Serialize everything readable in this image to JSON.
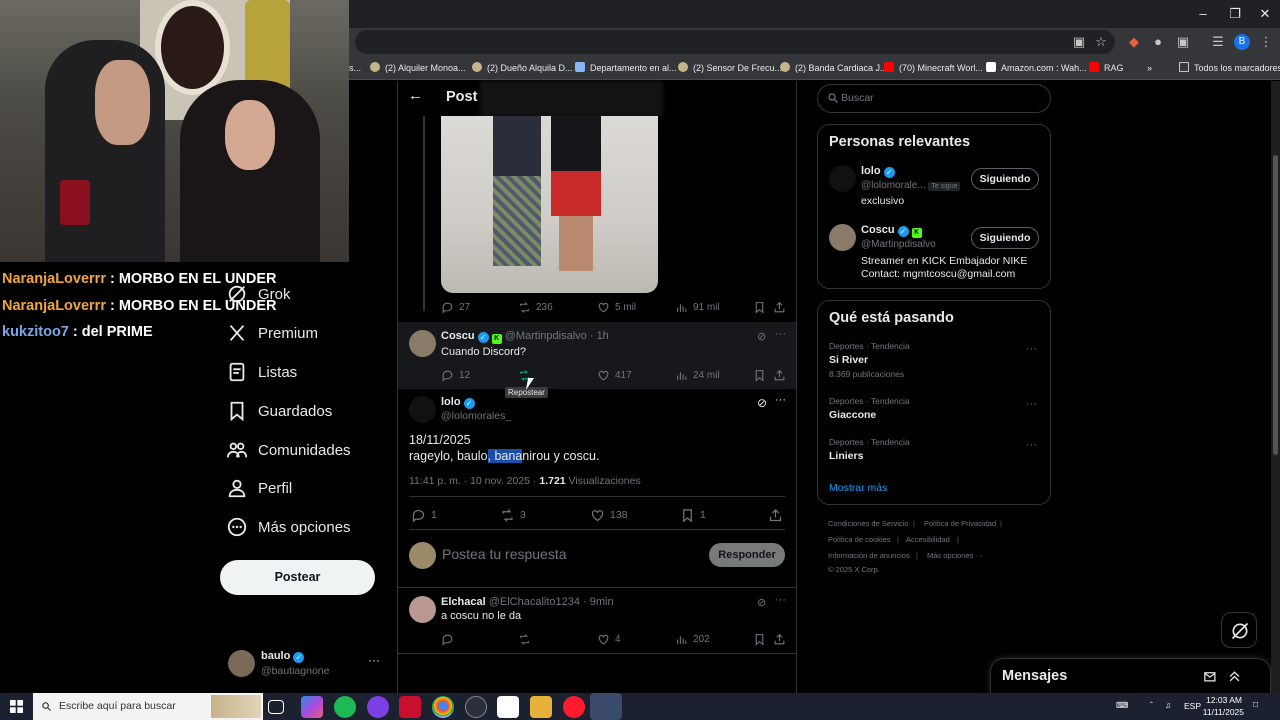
{
  "browser": {
    "bookmarks": [
      {
        "label": "(2) Alquiler Monoa...",
        "icon": "marketplace-icon"
      },
      {
        "label": "(2) Dueño Alquila D...",
        "icon": "marketplace-icon"
      },
      {
        "label": "Departamento en al...",
        "icon": "image-icon"
      },
      {
        "label": "(2) Sensor De Frecu...",
        "icon": "marketplace-icon"
      },
      {
        "label": "(2) Banda Cardiaca J...",
        "icon": "marketplace-icon"
      },
      {
        "label": "(70) Minecraft Worl...",
        "icon": "youtube-icon"
      },
      {
        "label": "Amazon.com : Wah...",
        "icon": "amazon-icon"
      },
      {
        "label": "RAG",
        "icon": "youtube-icon"
      }
    ],
    "all_bookmarks": "Todos los marcadores",
    "profile_initial": "B"
  },
  "stream_chat": [
    {
      "user": "NaranjaLoverrr",
      "message": " : MORBO EN EL UNDER",
      "color": "#f0a640"
    },
    {
      "user": "NaranjaLoverrr",
      "message": " : MORBO EN EL UNDER",
      "color": "#f0a640"
    },
    {
      "user": "kukzitoo7",
      "message": " : del PRIME",
      "color": "#79a8e8"
    }
  ],
  "nav": {
    "items": [
      {
        "label": "Grok",
        "icon": "grok-icon"
      },
      {
        "label": "Premium",
        "icon": "x-logo-icon"
      },
      {
        "label": "Listas",
        "icon": "list-icon"
      },
      {
        "label": "Guardados",
        "icon": "bookmark-icon"
      },
      {
        "label": "Comunidades",
        "icon": "communities-icon"
      },
      {
        "label": "Perfil",
        "icon": "person-icon"
      },
      {
        "label": "Más opciones",
        "icon": "more-circle-icon"
      }
    ],
    "post_button": "Postear",
    "account": {
      "name": "baulo",
      "handle": "@bautiagnone",
      "more": "···"
    }
  },
  "post": {
    "header_title": "Post",
    "parent_actions": {
      "replies": "27",
      "reposts": "236",
      "likes": "5 mil",
      "views": "91 mil"
    },
    "reply1": {
      "name": "Coscu",
      "handle": "@Martinpdisalvo",
      "time": "1h",
      "text": "Cuando Discord?",
      "replies": "12",
      "likes": "417",
      "views": "24 mil",
      "tooltip": "Repostear"
    },
    "main": {
      "name": "lolo",
      "handle": "@lolomorales_",
      "line1": "18/11/2025",
      "line2_pre": "rageylo, baulo",
      "line2_hl": ", bana",
      "line2_post": "nirou y coscu.",
      "timestamp": "11:41 p. m. · 10 nov. 2025 · ",
      "views_count": "1.721",
      "views_label": " Visualizaciones",
      "replies": "1",
      "reposts": "3",
      "likes": "138",
      "bookmarks": "1"
    },
    "compose_placeholder": "Postea tu respuesta",
    "reply_button": "Responder",
    "reply2": {
      "name": "Elchacal",
      "handle": "@ElChacalito1234",
      "time": "9min",
      "text": "a coscu no le da",
      "likes": "4",
      "views": "202"
    }
  },
  "sidebar": {
    "search_placeholder": "Buscar",
    "relevant_title": "Personas relevantes",
    "people": [
      {
        "name": "lolo",
        "handle": "@lolomorale...",
        "badge": "Te sigue",
        "bio": "exclusivo",
        "button": "Siguiendo"
      },
      {
        "name": "Coscu",
        "handle": "@Martinpdisalvo",
        "bio": "Streamer en KICK Embajador NIKE\nContact: mgmtcoscu@gmail.com",
        "bio_line1": "Streamer en KICK Embajador NIKE",
        "bio_line2": "Contact: mgmtcoscu@gmail.com",
        "button": "Siguiendo"
      }
    ],
    "trends_title": "Qué está pasando",
    "trends": [
      {
        "category": "Deportes · Tendencia",
        "name": "Si River",
        "count": "8.369 publicaciones"
      },
      {
        "category": "Deportes · Tendencia",
        "name": "Giaccone",
        "count": ""
      },
      {
        "category": "Deportes · Tendencia",
        "name": "Liniers",
        "count": ""
      }
    ],
    "show_more": "Mostrar más",
    "footer": {
      "terms": "Condiciones de Servicio",
      "privacy": "Política de Privacidad",
      "cookies": "Política de cookies",
      "accessibility": "Accesibilidad",
      "ads": "Información de anuncios",
      "more": "Más opciones ···",
      "copyright": "© 2025 X Corp."
    },
    "messages_title": "Mensajes"
  },
  "taskbar": {
    "search_placeholder": "Escribe aquí para buscar",
    "lang": "ESP",
    "time": "12:03 AM",
    "date": "11/11/2025"
  },
  "colors": {
    "accent": "#1d9bf0",
    "repost_green": "#00ba7c",
    "kick_green": "#53fc18"
  }
}
